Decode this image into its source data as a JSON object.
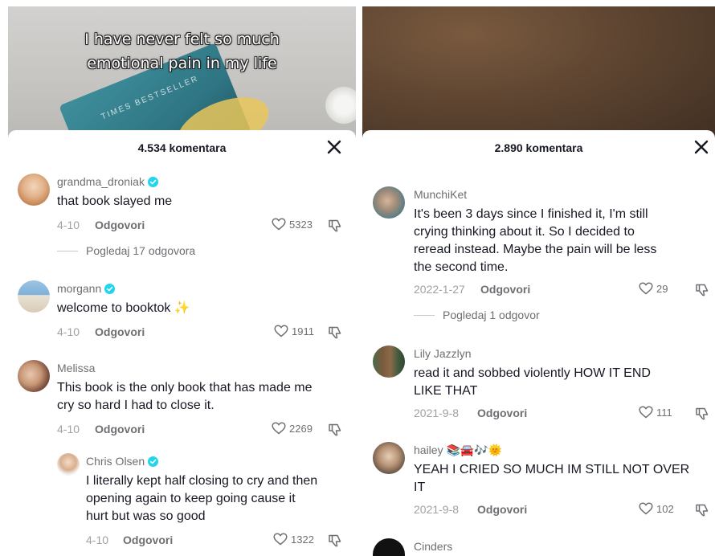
{
  "left": {
    "caption_line1": "I have never felt so much",
    "caption_line2": "emotional pain in my life",
    "book_text": "TIMES BESTSELLER",
    "comment_count": "4.534 komentara",
    "comments": [
      {
        "username": "grandma_droniak",
        "verified": true,
        "text": "that book slayed me",
        "date": "4-10",
        "reply_label": "Odgovori",
        "likes": "5323",
        "view_replies": "Pogledaj 17 odgovora"
      },
      {
        "username": "morgann",
        "verified": true,
        "text": "welcome to booktok",
        "emoji": "✨",
        "date": "4-10",
        "reply_label": "Odgovori",
        "likes": "1911"
      },
      {
        "username": "Melissa",
        "verified": false,
        "text_line1": "This book is the only book that has made me",
        "text_line2": "cry so hard I had to close it.",
        "date": "4-10",
        "reply_label": "Odgovori",
        "likes": "2269"
      },
      {
        "username": "Chris Olsen",
        "verified": true,
        "text_line1": "I literally kept half closing to cry and then",
        "text_line2": "opening again to keep going cause it",
        "text_line3": "hurt but was so good",
        "date": "4-10",
        "reply_label": "Odgovori",
        "likes": "1322"
      }
    ]
  },
  "right": {
    "comment_count": "2.890 komentara",
    "comments": [
      {
        "username": "MunchiKet",
        "text_line1": "It's been 3 days since I finished it, I'm still",
        "text_line2": "crying thinking about it. So I decided to",
        "text_line3": "reread instead. Maybe the pain will be less",
        "text_line4": "the second time.",
        "date": "2022-1-27",
        "reply_label": "Odgovori",
        "likes": "29",
        "view_replies": "Pogledaj 1 odgovor"
      },
      {
        "username": "Lily Jazzlyn",
        "text_line1": "read it and sobbed violently HOW IT END",
        "text_line2": "LIKE THAT",
        "date": "2021-9-8",
        "reply_label": "Odgovori",
        "likes": "111"
      },
      {
        "username": "hailey",
        "username_emoji": "📚🚘🎶🌞",
        "text_line1": "YEAH I CRIED SO MUCH IM STILL NOT OVER",
        "text_line2": "IT",
        "date": "2021-9-8",
        "reply_label": "Odgovori",
        "likes": "102"
      },
      {
        "username": "Cinders"
      }
    ]
  },
  "colors": {
    "verified": "#20d5ec",
    "text": "#161823",
    "muted": "#a0a0a6"
  },
  "icons": {
    "close": "close-icon",
    "like": "heart-outline-icon",
    "dislike": "thumbs-down-icon",
    "verified": "verified-badge-icon"
  }
}
